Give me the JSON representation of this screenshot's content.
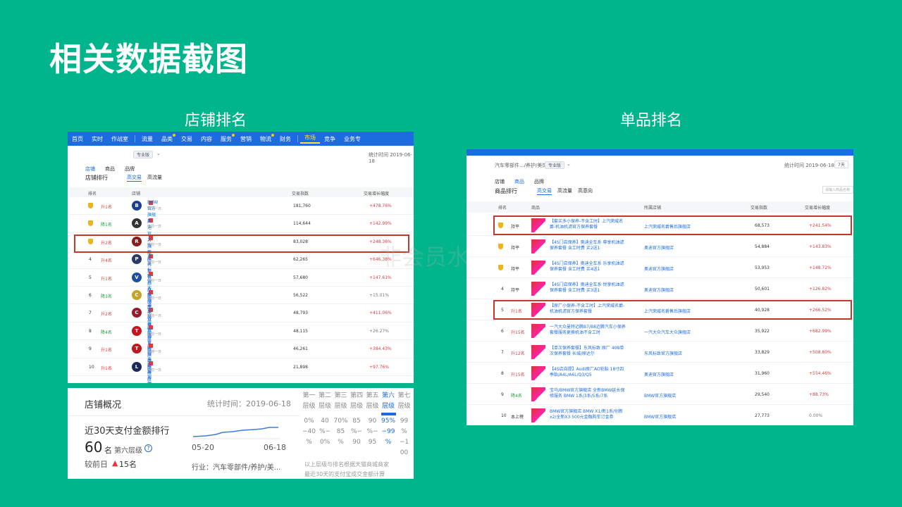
{
  "slide": {
    "title": "相关数据截图",
    "left_subtitle": "店铺排名",
    "right_subtitle": "单品排名"
  },
  "shop_panel": {
    "nav": [
      {
        "label": "首页"
      },
      {
        "label": "实时"
      },
      {
        "label": "作战室"
      },
      {
        "label": "流量"
      },
      {
        "label": "品类",
        "dot": true
      },
      {
        "label": "交易"
      },
      {
        "label": "内容"
      },
      {
        "label": "服务",
        "dot": true
      },
      {
        "label": "营销"
      },
      {
        "label": "物流",
        "dot": true
      },
      {
        "label": "财务"
      },
      {
        "label": "市场",
        "active": true
      },
      {
        "label": "竞争"
      },
      {
        "label": "业务专"
      }
    ],
    "edition_chip": "专业版",
    "stat_time": "统计时间 2019-06-18",
    "tabs": [
      "店铺",
      "商品",
      "品牌"
    ],
    "section_label": "店铺排行",
    "subtabs": [
      "高交易",
      "高流量"
    ],
    "columns": {
      "rank": "排名",
      "shop": "店铺",
      "index": "交易指数",
      "growth": "交易增长幅度"
    },
    "rows": [
      {
        "rank": "",
        "change": "升1名",
        "dir": "up",
        "shop": "BMW官方旗舰店",
        "sub": "较前一日",
        "logo_color": "#1c3f94",
        "logo": "B",
        "index": "181,760",
        "growth": "+478.76%",
        "medal": true
      },
      {
        "rank": "",
        "change": "降1名",
        "dir": "down",
        "shop": "奥迪官方旗舰店",
        "sub": "较前一日",
        "logo_color": "#333333",
        "logo": "A",
        "index": "114,644",
        "growth": "+142.99%",
        "medal": true
      },
      {
        "rank": "",
        "change": "升2名",
        "dir": "up",
        "shop": "上汽荣威名爵售后旗舰店",
        "sub": "较前一日",
        "logo_color": "#8a1c1c",
        "logo": "R",
        "index": "83,028",
        "growth": "+248.36%",
        "medal": true
      },
      {
        "rank": "4",
        "change": "升4名",
        "dir": "up",
        "shop": "东风标致官方旗舰店",
        "sub": "较前一日",
        "logo_color": "#2a3a6a",
        "logo": "P",
        "index": "62,265",
        "growth": "+646.38%"
      },
      {
        "rank": "5",
        "change": "升1名",
        "dir": "up",
        "shop": "一汽大众汽车大众旗舰店",
        "sub": "较前一日",
        "logo_color": "#1f4fa0",
        "logo": "V",
        "index": "57,680",
        "growth": "+147.61%"
      },
      {
        "rank": "6",
        "change": "降3名",
        "dir": "down",
        "shop": "上汽通用雪佛兰官方旗...",
        "sub": "较前一日",
        "logo_color": "#c9a227",
        "logo": "C",
        "index": "56,522",
        "growth": "+15.01%",
        "neutral": true
      },
      {
        "rank": "7",
        "change": "升2名",
        "dir": "up",
        "shop": "东风雪铁龙官方旗舰店",
        "sub": "较前一日",
        "logo_color": "#9a1c2c",
        "logo": "C",
        "index": "48,793",
        "growth": "+411.06%"
      },
      {
        "rank": "8",
        "change": "降4名",
        "dir": "down",
        "shop": "一汽丰田官方旗舰店",
        "sub": "较前一日",
        "logo_color": "#c4161c",
        "logo": "T",
        "index": "48,115",
        "growth": "+26.27%",
        "neutral": true
      },
      {
        "rank": "9",
        "change": "升1名",
        "dir": "up",
        "shop": "广汽丰田官方旗舰店",
        "sub": "较前一日",
        "logo_color": "#c4161c",
        "logo": "T",
        "index": "46,261",
        "growth": "+384.43%"
      },
      {
        "rank": "10",
        "change": "升1名",
        "dir": "up",
        "shop": "乐车邦旗舰店",
        "sub": "较前一日",
        "logo_color": "#1c2a5a",
        "logo": "L",
        "index": "21,898",
        "growth": "+97.76%"
      }
    ],
    "watermark": "非会员水印"
  },
  "overview": {
    "title": "店铺概况",
    "stat_time": "统计时间：2019-06-18",
    "metric_label": "近30天支付金额排行",
    "rank_value": "60",
    "rank_unit": "名",
    "tier": "第六层级",
    "prev_label": "较前日",
    "change": "15名",
    "date_start": "05-20",
    "date_end": "06-18",
    "industry": "行业：汽车零部件/养护/美..."
  },
  "tier_table": {
    "columns": [
      {
        "head": "第一",
        "tier": "层级",
        "r1": "0%",
        "r2": "−40",
        "r3": "%"
      },
      {
        "head": "第二",
        "tier": "层级",
        "r1": "40",
        "r2": "%−",
        "r3": "0%"
      },
      {
        "head": "第三",
        "tier": "层级",
        "r1": "70%",
        "r2": "85",
        "r3": "%"
      },
      {
        "head": "第四",
        "tier": "层级",
        "r1": "85",
        "r2": "%−",
        "r3": "90"
      },
      {
        "head": "第五",
        "tier": "层级",
        "r1": "90",
        "r2": "%−",
        "r3": "95"
      },
      {
        "head": "第六",
        "tier": "层级",
        "r1": "95%",
        "r2": "−99",
        "r3": "%",
        "highlight": true
      },
      {
        "head": "第七",
        "tier": "层级",
        "r1": "99",
        "r2": "%−1",
        "r3": "00"
      }
    ],
    "foot1": "以上层级与排名根据天猫商城商家",
    "foot2": "最近30天的支付宝成交金额计算"
  },
  "product_panel": {
    "breadcrumb": "汽车零部件.../养护/美饰",
    "edition_chip": "专业版",
    "stat_time": "统计时间 2019-06-18",
    "range": "7天",
    "tabs": [
      "店铺",
      "商品",
      "品牌"
    ],
    "section_label": "商品排行",
    "subtabs": [
      "高交易",
      "高流量",
      "高意向"
    ],
    "search_placeholder": "请输入商品名称",
    "columns": {
      "rank": "排名",
      "product": "商品",
      "shop": "所属店铺",
      "index": "交易指数",
      "growth": "交易增长幅度"
    },
    "rows": [
      {
        "rank": "",
        "change": "持平",
        "dir": "flat",
        "name": "【套买多小保养-不含工时】上汽荣威名爵-机油机滤官方保养套餐",
        "shop": "上汽荣威名爵售后旗舰店",
        "index": "68,573",
        "growth": "+241.54%",
        "medal": true
      },
      {
        "rank": "",
        "change": "持平",
        "dir": "flat",
        "name": "【4S门店保养】奥迪全车系 尊享机油滤保养套餐 含工时费 买2送1",
        "shop": "奥迪官方旗舰店",
        "index": "54,884",
        "growth": "+143.83%",
        "medal": true
      },
      {
        "rank": "",
        "change": "持平",
        "dir": "flat",
        "name": "【4S门店保养】奥迪全车系 乐享机油滤保养套餐 含工时费 买4送1",
        "shop": "奥迪官方旗舰店",
        "index": "53,953",
        "growth": "+148.72%",
        "medal": true
      },
      {
        "rank": "4",
        "change": "持平",
        "dir": "flat",
        "name": "【4S门店保养】奥迪全车系 悦享机油滤保养套餐 含工时费 买3送1",
        "shop": "奥迪官方旗舰店",
        "index": "50,601",
        "growth": "+126.82%"
      },
      {
        "rank": "5",
        "change": "升1名",
        "dir": "up",
        "name": "【原厂小保养-不含工时】上汽荣威名爵-机油机滤官方保养套餐",
        "shop": "上汽荣威名爵售后旗舰店",
        "index": "40,928",
        "growth": "+266.52%"
      },
      {
        "rank": "6",
        "change": "升15名",
        "dir": "up",
        "name": "一汽大众曼特迈腾B7/B8迈腾汽车小保养套餐服务更换机油不含工时",
        "shop": "一汽大众汽车大众旗舰店",
        "index": "35,922",
        "growth": "+682.99%"
      },
      {
        "rank": "7",
        "change": "升12名",
        "dir": "up",
        "name": "【单次保养套餐】东风标致 原厂 408单次保养套餐 长城/原达尔",
        "shop": "东风标致官方旗舰店",
        "index": "33,829",
        "growth": "+508.80%"
      },
      {
        "rank": "8",
        "change": "升15名",
        "dir": "up",
        "name": "【4S店自提】Audi原厂AO轮胎 18寸四季胎/A4L/A6L/Q3/Q5",
        "shop": "奥迪官方旗舰店",
        "index": "31,960",
        "growth": "+554.46%"
      },
      {
        "rank": "9",
        "change": "降4名",
        "dir": "down",
        "name": "宝马/BMW官方旗舰店 全新BMW延长保修服务 BMW 1系/3系/5系/7系",
        "shop": "BMW官方旗舰店",
        "index": "29,540",
        "growth": "+88.73%"
      },
      {
        "rank": "10",
        "change": "本上榜",
        "dir": "flat",
        "name": "BMW官方旗舰店 BMW X1/新1系/创新x2/全新X3 500元金融购车订金券",
        "shop": "BMW官方旗舰店",
        "index": "27,773",
        "growth": "0.00%",
        "neutral": true
      }
    ]
  }
}
